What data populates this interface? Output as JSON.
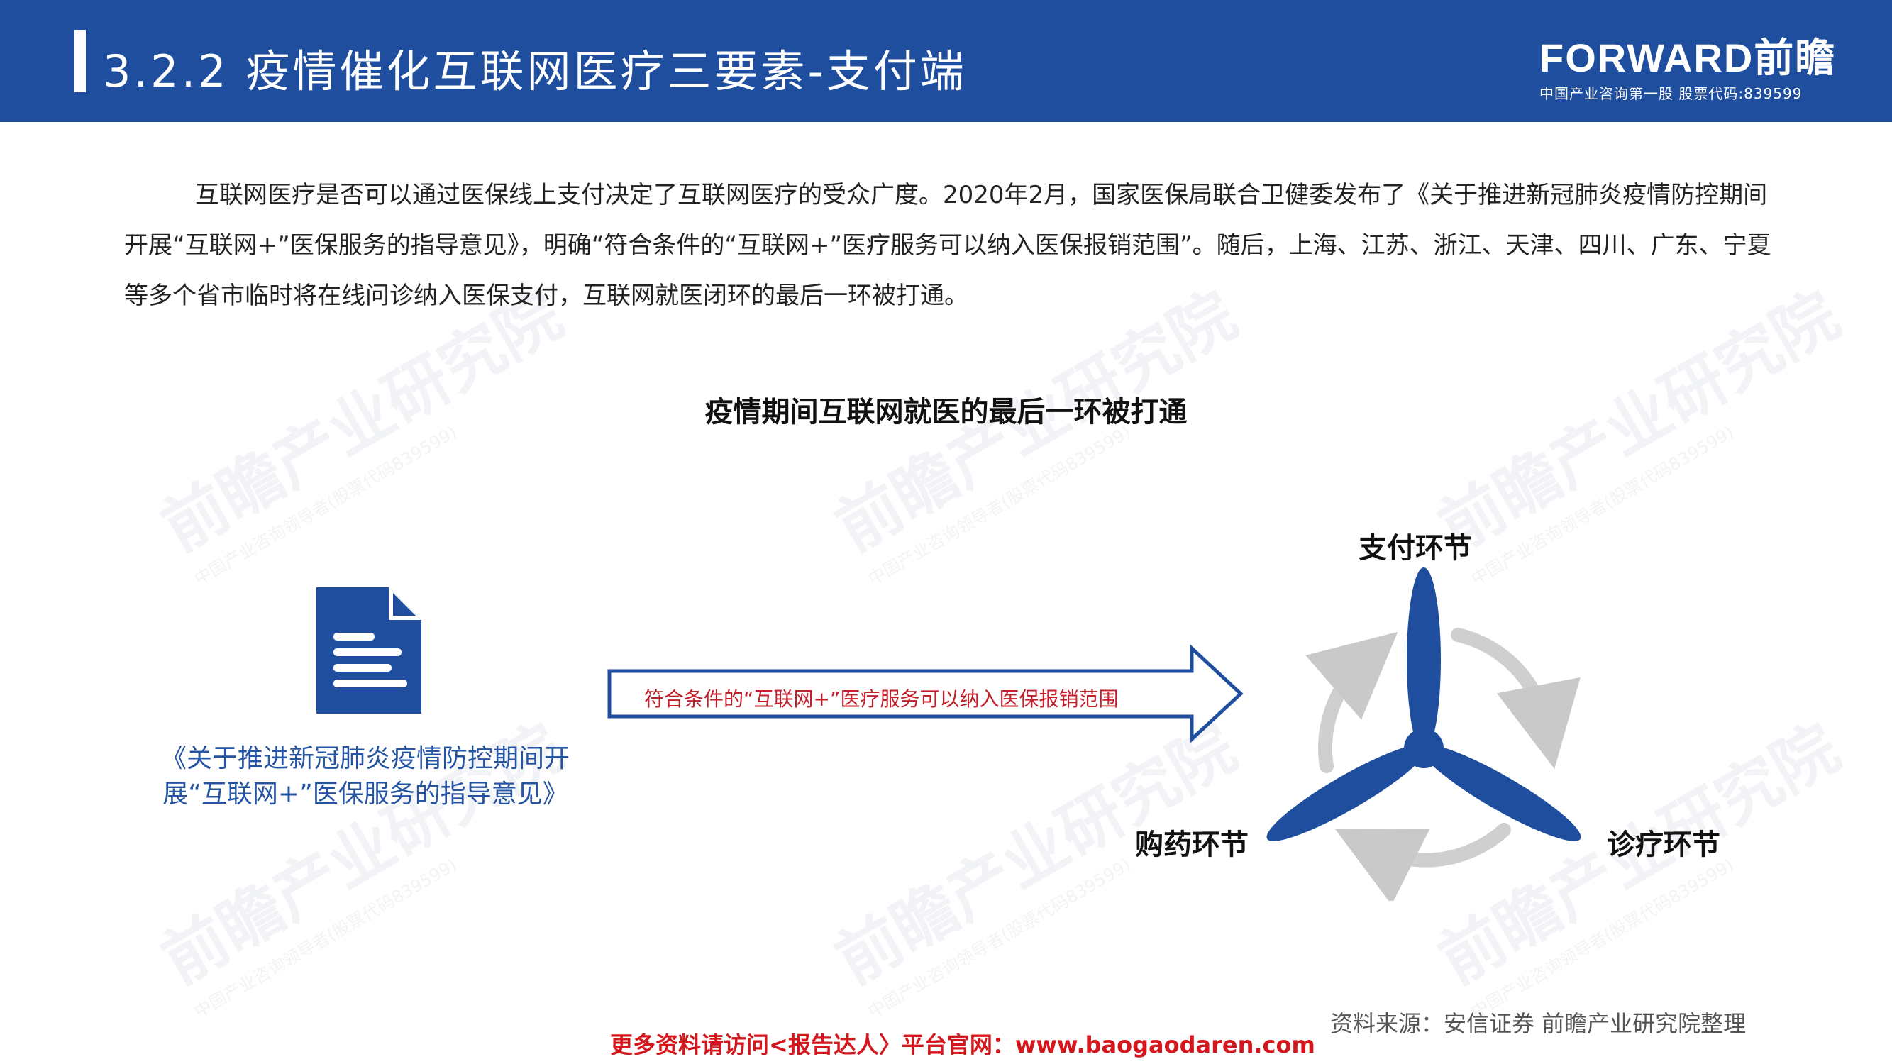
{
  "header": {
    "title": "3.2.2 疫情催化互联网医疗三要素-支付端",
    "brand_logo": "FORWARD前瞻",
    "brand_subtitle": "中国产业咨询第一股  股票代码:839599",
    "bg_color": "#1f4e9e"
  },
  "intro": {
    "text": "互联网医疗是否可以通过医保线上支付决定了互联网医疗的受众广度。2020年2月，国家医保局联合卫健委发布了《关于推进新冠肺炎疫情防控期间开展“互联网+”医保服务的指导意见》，明确“符合条件的“互联网+”医疗服务可以纳入医保报销范围”。随后，上海、江苏、浙江、天津、四川、广东、宁夏等多个省市临时将在线问诊纳入医保支付，互联网就医闭环的最后一环被打通。"
  },
  "diagram": {
    "title": "疫情期间互联网就医的最后一环被打通",
    "document_caption": "《关于推进新冠肺炎疫情防控期间开展“互联网+”医保服务的指导意见》",
    "arrow_text": "符合条件的“互联网+”医疗服务可以纳入医保报销范围",
    "stages": {
      "top": "支付环节",
      "left": "购药环节",
      "right": "诊疗环节"
    },
    "accent_color": "#1f4e9e",
    "arrow_text_color": "#c0202a"
  },
  "watermark": {
    "text": "前瞻产业研究院",
    "sub": "中国产业咨询领导者(股票代码839599)"
  },
  "source": "资料来源：安信证券  前瞻产业研究院整理",
  "footer": "更多资料请访问<报告达人〉平台官网：www.baogaodaren.com"
}
